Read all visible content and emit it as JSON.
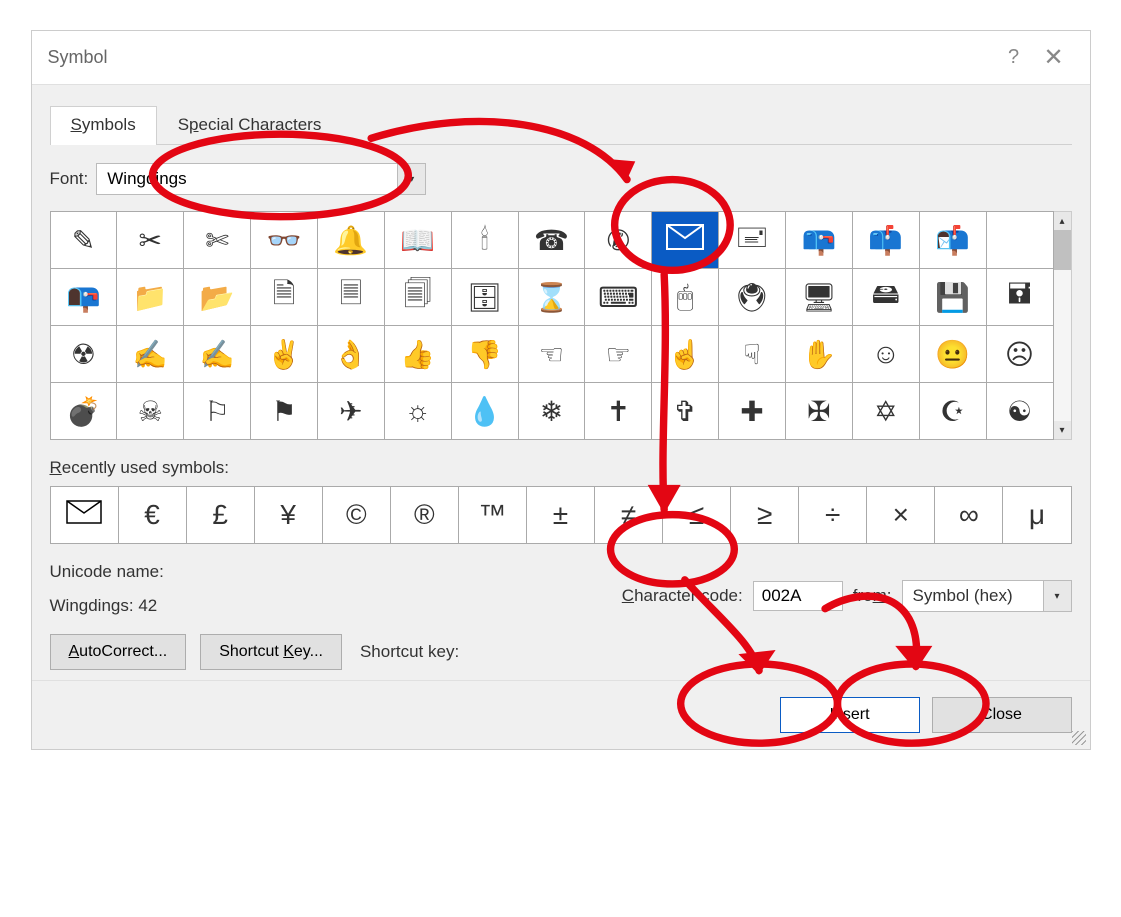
{
  "titlebar": {
    "title": "Symbol"
  },
  "tabs": {
    "symbols": "Symbols",
    "special": "Special Characters"
  },
  "font": {
    "label": "Font:",
    "value": "Wingdings"
  },
  "grid": {
    "rows": [
      [
        "pencil",
        "scissors",
        "scissors2",
        "glasses",
        "bell",
        "book",
        "candle",
        "phone",
        "phone2",
        "envelope",
        "envelope-closed",
        "mailbox",
        "mailbox2",
        "mailbox3"
      ],
      [
        "mailbox-open",
        "folder",
        "folder-open",
        "doc",
        "doc-lines",
        "docs-stack",
        "filing",
        "hourglass",
        "keyboard",
        "mouse",
        "trackball",
        "computer",
        "harddrive",
        "floppy",
        "floppy-black"
      ],
      [
        "radiation",
        "hand-write",
        "hand-write2",
        "victory",
        "ok",
        "thumbs-up",
        "thumbs-down",
        "point-left",
        "point-right",
        "point-up",
        "point-down",
        "stop-hand",
        "smile",
        "neutral",
        "frown"
      ],
      [
        "bomb",
        "skull",
        "flag",
        "flag2",
        "plane",
        "sun",
        "drop",
        "snowflake",
        "cross",
        "cross-outline",
        "cross-greek",
        "maltese",
        "star-david",
        "crescent",
        "yinyang"
      ]
    ],
    "selected": [
      0,
      9
    ]
  },
  "recent": {
    "label": "Recently used symbols:",
    "items": [
      "envelope",
      "€",
      "£",
      "¥",
      "©",
      "®",
      "™",
      "±",
      "≠",
      "≤",
      "≥",
      "÷",
      "×",
      "∞",
      "μ"
    ]
  },
  "unicode": {
    "name_label": "Unicode name:",
    "name_value": "Wingdings: 42"
  },
  "charcode": {
    "label": "Character code:",
    "value": "002A"
  },
  "from": {
    "label": "from:",
    "value": "Symbol (hex)"
  },
  "buttons": {
    "autocorrect": "AutoCorrect...",
    "shortcut_key": "Shortcut Key...",
    "shortcut_label": "Shortcut key:",
    "insert": "Insert",
    "close": "Close"
  }
}
